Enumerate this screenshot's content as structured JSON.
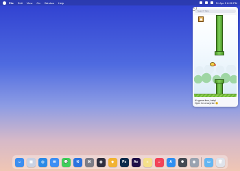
{
  "menubar": {
    "app_name": "File",
    "items": [
      "Edit",
      "View",
      "Go",
      "Window",
      "Help"
    ],
    "clock": "Fri Apr 5 8:28 PM"
  },
  "widget": {
    "close_glyph": "×",
    "search_placeholder": "Search Tabs",
    "caption_line1": "It's game time, baby!",
    "caption_line2": "Open for a surprise 😉"
  },
  "dock": {
    "apps": [
      {
        "name": "finder",
        "label": "☺",
        "color": "#3c8ef0"
      },
      {
        "name": "launchpad",
        "label": "▦",
        "color": "#c9d2e4"
      },
      {
        "name": "safari",
        "label": "◎",
        "color": "#2a8ae6"
      },
      {
        "name": "mail",
        "label": "✉",
        "color": "#3d8ff4"
      },
      {
        "name": "messages",
        "label": "💬",
        "color": "#3fcf5a"
      },
      {
        "name": "xcode",
        "label": "⚒",
        "color": "#2b74df"
      },
      {
        "name": "scripting-app",
        "label": "⌘",
        "color": "#7d7d86"
      },
      {
        "name": "system-monitor",
        "label": "◍",
        "color": "#303040"
      },
      {
        "name": "sketch",
        "label": "◆",
        "color": "#f2b331"
      },
      {
        "name": "photoshop",
        "label": "Ps",
        "color": "#0b2a4a"
      },
      {
        "name": "after-effects",
        "label": "Ae",
        "color": "#1f0f47"
      },
      {
        "name": "notes",
        "label": "≡",
        "color": "#f5e08a"
      },
      {
        "name": "music",
        "label": "♫",
        "color": "#f24459"
      },
      {
        "name": "app-store",
        "label": "A",
        "color": "#2f8ff1"
      },
      {
        "name": "chatgpt",
        "label": "✺",
        "color": "#444a52"
      },
      {
        "name": "screenshot",
        "label": "◉",
        "color": "#9aa3b0"
      },
      {
        "name": "folder",
        "label": "▭",
        "color": "#63b6f2"
      },
      {
        "name": "trash",
        "label": "🗑",
        "color": "#dfe3ea"
      }
    ]
  }
}
